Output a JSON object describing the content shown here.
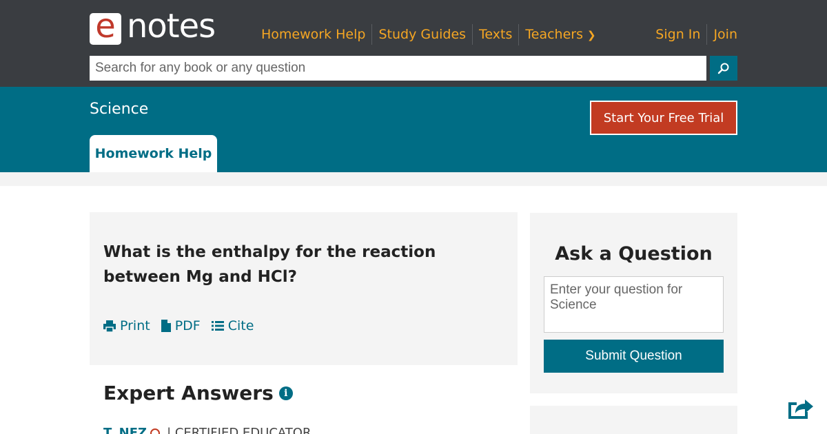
{
  "header": {
    "logo": {
      "mark": "e",
      "wordmark": "notes"
    },
    "nav": [
      {
        "label": "Homework Help"
      },
      {
        "label": "Study Guides"
      },
      {
        "label": "Texts"
      },
      {
        "label": "Teachers",
        "icon": "chevron-right-icon"
      }
    ],
    "auth": {
      "sign_in": "Sign In",
      "join": "Join"
    },
    "search": {
      "placeholder": "Search for any book or any question",
      "button_icon": "search-icon"
    }
  },
  "subheader": {
    "subject": "Science",
    "trial_button": "Start Your Free Trial",
    "active_tab": "Homework Help"
  },
  "question": {
    "title": "What is the enthalpy for the reaction between Mg and HCl?",
    "actions": [
      {
        "label": "Print",
        "icon": "print-icon"
      },
      {
        "label": "PDF",
        "icon": "file-icon"
      },
      {
        "label": "Cite",
        "icon": "list-icon"
      }
    ]
  },
  "answers": {
    "heading": "Expert Answers",
    "info_icon": "info-icon",
    "author": {
      "name": "T. NEZ",
      "badge_icon": "certified-icon",
      "role": "| CERTIFIED EDUCATOR"
    }
  },
  "ask": {
    "heading": "Ask a Question",
    "placeholder": "Enter your question for Science",
    "submit": "Submit Question"
  },
  "colors": {
    "topbar": "#3a3d41",
    "accent_orange": "#f5a623",
    "brand_teal": "#006d85",
    "trial_red": "#c23b22",
    "card_gray": "#f4f4f4"
  }
}
